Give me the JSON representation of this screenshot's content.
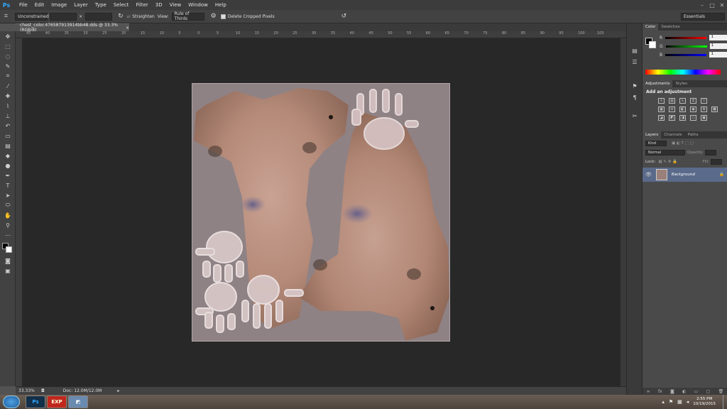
{
  "menubar": {
    "logo": "Ps",
    "items": [
      "File",
      "Edit",
      "Image",
      "Layer",
      "Type",
      "Select",
      "Filter",
      "3D",
      "View",
      "Window",
      "Help"
    ],
    "win_min": "–",
    "win_max": "□",
    "win_close": "✕"
  },
  "options": {
    "ratio": "Unconstrained",
    "swap": "×",
    "straighten": "Straighten",
    "view_label": "View:",
    "view_value": "Rule of Thirds",
    "delete_cropped": "Delete Cropped Pixels",
    "workspace": "Essentials"
  },
  "document": {
    "tab_title": "chest_color.476587913914bb48.dds @ 33.3% (RGB/8)",
    "tab_close": "×"
  },
  "ruler_ticks": [
    "45",
    "40",
    "35",
    "30",
    "25",
    "20",
    "15",
    "10",
    "5",
    "0",
    "5",
    "10",
    "15",
    "20",
    "25",
    "30",
    "35",
    "40",
    "45",
    "50",
    "55",
    "60",
    "65",
    "70",
    "75",
    "80",
    "85",
    "90",
    "95",
    "100",
    "105"
  ],
  "status": {
    "zoom": "33.33%",
    "doc": "Doc: 12.0M/12.0M"
  },
  "color_panel": {
    "tabs": [
      "Color",
      "Swatches"
    ],
    "r_label": "R",
    "g_label": "G",
    "b_label": "B",
    "r_value": "1",
    "g_value": "1",
    "b_value": "1"
  },
  "adjustments_panel": {
    "tabs": [
      "Adjustments",
      "Styles"
    ],
    "heading": "Add an adjustment"
  },
  "layers_panel": {
    "tabs": [
      "Layers",
      "Channels",
      "Paths"
    ],
    "kind": "Kind",
    "blend": "Normal",
    "opacity_label": "Opacity:",
    "lock_label": "Lock:",
    "fill_label": "Fill:",
    "layer_name": "Background"
  },
  "taskbar": {
    "clock_time": "2:55 PM",
    "clock_date": "10/19/2015",
    "ps_label": "Ps",
    "exp_label": "EXP"
  },
  "colors": {
    "accent": "#31a8ff",
    "canvas_bg": "#8f8285",
    "workspace": "#282828"
  }
}
